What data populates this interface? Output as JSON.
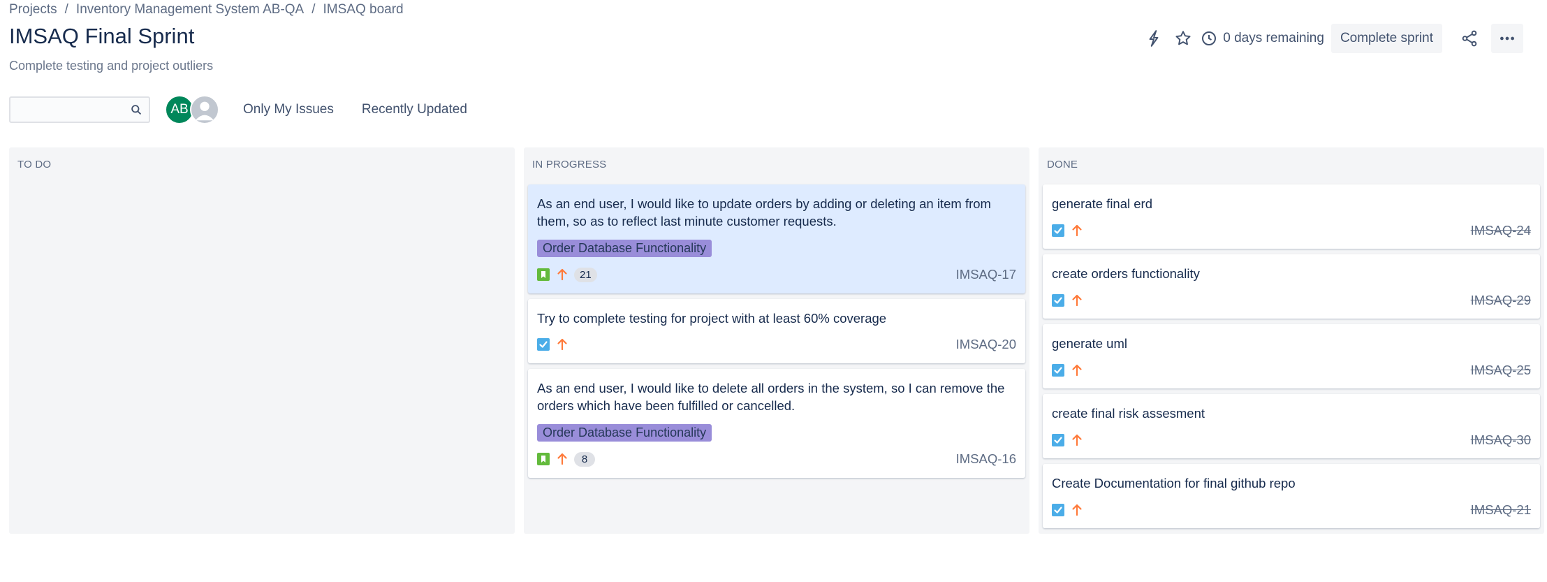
{
  "breadcrumb": {
    "items": [
      "Projects",
      "Inventory Management System AB-QA",
      "IMSAQ board"
    ],
    "separator": "/"
  },
  "page": {
    "title": "IMSAQ Final Sprint",
    "goal": "Complete testing and project outliers"
  },
  "header": {
    "days_remaining": "0 days remaining",
    "complete_label": "Complete sprint",
    "icons": [
      "automation-bolt-icon",
      "star-icon",
      "clock-icon",
      "share-icon",
      "more-icon"
    ]
  },
  "filters": {
    "search_placeholder": "",
    "avatar_initials": "AB",
    "only_my_issues": "Only My Issues",
    "recently_updated": "Recently Updated"
  },
  "colors": {
    "avatar": "#00875a",
    "epic": "#998dd9",
    "story": "#63ba3c",
    "task": "#4bade8",
    "priority_high": "#ff7a3a",
    "selected_card": "#deebff"
  },
  "columns": [
    {
      "title": "TO DO",
      "cards": []
    },
    {
      "title": "IN PROGRESS",
      "cards": [
        {
          "summary": "As an end user, I would like to update orders by adding or deleting an item from them, so as to reflect last minute customer requests.",
          "epic": "Order Database Functionality",
          "type": "story",
          "priority": "high",
          "estimate": "21",
          "key": "IMSAQ-17",
          "selected": true
        },
        {
          "summary": "Try to complete testing for project with at least 60% coverage",
          "type": "task",
          "priority": "high",
          "key": "IMSAQ-20"
        },
        {
          "summary": "As an end user, I would like to delete all orders in the system, so I can remove the orders which have been fulfilled or cancelled.",
          "epic": "Order Database Functionality",
          "type": "story",
          "priority": "high",
          "estimate": "8",
          "key": "IMSAQ-16"
        }
      ]
    },
    {
      "title": "DONE",
      "cards": [
        {
          "summary": "generate final erd",
          "type": "task",
          "priority": "high",
          "key": "IMSAQ-24"
        },
        {
          "summary": "create orders functionality",
          "type": "task",
          "priority": "high",
          "key": "IMSAQ-29"
        },
        {
          "summary": "generate uml",
          "type": "task",
          "priority": "high",
          "key": "IMSAQ-25"
        },
        {
          "summary": "create final risk assesment",
          "type": "task",
          "priority": "high",
          "key": "IMSAQ-30"
        },
        {
          "summary": "Create Documentation for final github repo",
          "type": "task",
          "priority": "high",
          "key": "IMSAQ-21"
        }
      ]
    }
  ]
}
